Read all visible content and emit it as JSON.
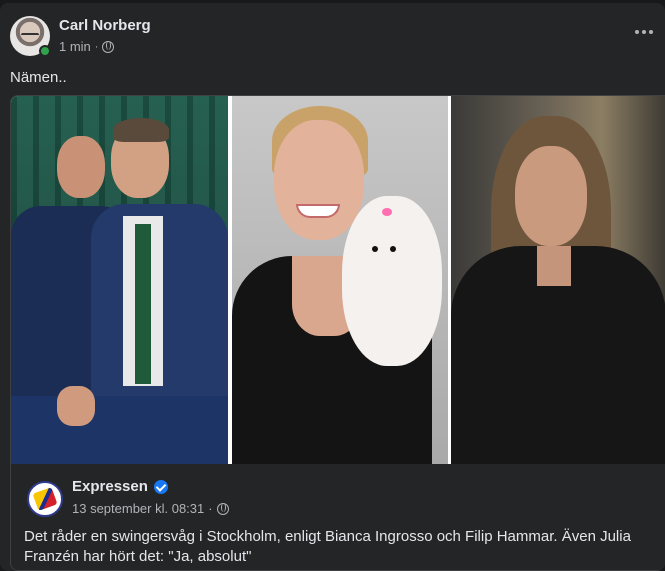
{
  "post": {
    "author": "Carl Norberg",
    "time": "1 min",
    "separator": "·",
    "text": "Nämen..",
    "more_icon": "more-options-icon",
    "privacy_icon": "globe-icon"
  },
  "shared": {
    "page_name": "Expressen",
    "date": "13 september kl. 08:31",
    "separator": "·",
    "text": "Det råder en swingersvåg i Stockholm, enligt Bianca Ingrosso och Filip Hammar. Även Julia Franzén har hört det: \"Ja, absolut\"",
    "verified_icon": "verified-badge-icon"
  },
  "colors": {
    "background": "#18191a",
    "card": "#242526",
    "text_primary": "#e4e6eb",
    "text_secondary": "#b0b3b8",
    "online": "#31a24c",
    "verified": "#1877f2"
  }
}
